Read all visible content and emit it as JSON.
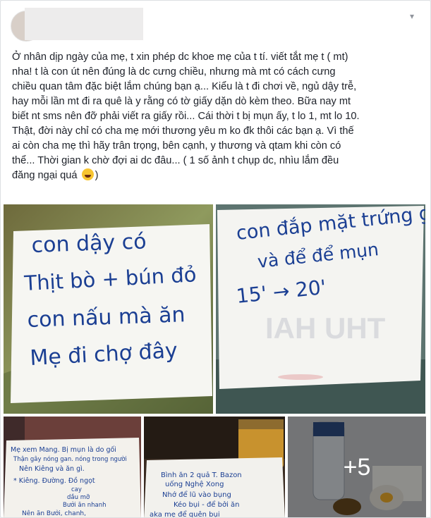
{
  "post": {
    "text_lines": [
      "Ở nhân dịp ngày của mẹ, t xin phép dc khoe mẹ của t tí. viết tắt mẹ t ( mt)",
      "nha! t là con út nên đúng là dc cưng chiều, nhưng mà mt có cách cưng",
      "chiều quan tâm đặc biệt lắm chúng bạn ạ... Kiểu là t đi chơi về, ngủ dậy trễ,",
      "hay mỗi lần mt đi ra quê là y rằng có tờ giấy dặn dò kèm theo. Bữa nay mt",
      "biết nt sms nên đỡ phải viết ra giấy rồi... Cái thời t bị mụn ấy, t lo 1, mt lo 10.",
      "Thật, đời này chỉ có cha mẹ mới thương yêu m ko đk thôi các bạn ạ. Vì thế",
      "ai còn cha mẹ thì hãy trân trọng, bên cạnh, y thương và qtam khi còn có",
      "thể... Thời gian k chờ đợi ai dc đâu... ( 1 số ảnh t chụp dc, nhìu lắm đều",
      "đăng ngại quá"
    ],
    "text_end": ")",
    "emoji_icon": "laughing-face-icon",
    "menu_icon": "chevron-down-icon"
  },
  "photos": {
    "note1": {
      "lines": [
        "con dậy có",
        "Thịt bò + bún đỏ",
        "con nấu mà ăn",
        "Mẹ đi chợ đây"
      ]
    },
    "note2": {
      "lines": [
        "con đắp mặt trứng gà",
        "và để để mụn",
        "15' → 20'"
      ]
    },
    "note3": {
      "lines": [
        "Mẹ xem Mang. Bị mụn là do gối",
        "Thận gây nóng gan. nóng trong người",
        "Nên Kiêng và ăn gì.",
        "* Kiêng. Đường. Đồ ngọt",
        "cay",
        "dầu mỡ",
        "Bưởi ăn nhanh",
        "Nên ăn Bưởi, chanh,"
      ]
    },
    "note4": {
      "lines": [
        "Bình ăn 2 quả T. Bazon",
        "uống Nghệ Xong",
        "Nhớ để lũ vào bụng",
        "Kéo bụi - để bởi ăn",
        "aka mẹ để quên bụi"
      ]
    },
    "more_count": "+5"
  },
  "colors": {
    "ink": "#1b3f93",
    "text": "#1d2129",
    "overlay": "#000000"
  }
}
